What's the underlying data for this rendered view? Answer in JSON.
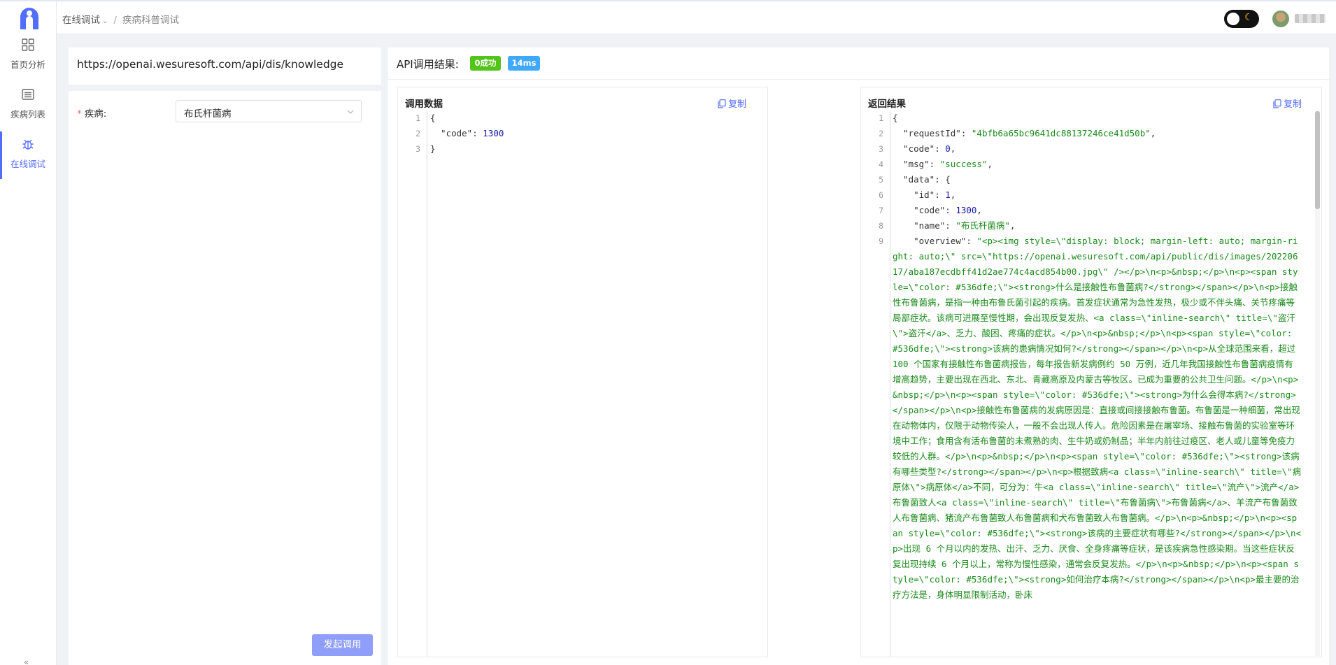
{
  "sidebar": {
    "items": [
      {
        "label": "首页分析",
        "icon": "dashboard-grid-icon"
      },
      {
        "label": "疾病列表",
        "icon": "list-icon"
      },
      {
        "label": "在线调试",
        "icon": "bug-icon",
        "active": true
      }
    ],
    "collapse_label": "«"
  },
  "breadcrumb": {
    "parent": "在线调试",
    "separator": "/",
    "current": "疾病科普调试"
  },
  "header": {
    "theme_toggle_icon": "moon-icon"
  },
  "request": {
    "url": "https://openai.wesuresoft.com/api/dis/knowledge"
  },
  "form": {
    "disease_label": "疾病:",
    "required_mark": "*",
    "disease_value": "布氏杆菌病",
    "submit_label": "发起调用"
  },
  "result": {
    "title": "API调用结果:",
    "status_badge": "0成功",
    "time_badge": "14ms",
    "colors": {
      "success": "#52c41a",
      "time": "#40a9ff",
      "accent": "#536dfe"
    }
  },
  "call_data": {
    "title": "调用数据",
    "copy_label": "复制",
    "lines": [
      "{",
      "  \"code\": 1300",
      "}"
    ]
  },
  "response": {
    "title": "返回结果",
    "copy_label": "复制",
    "request_id": "\"4bfb6a65bc9641dc88137246ce41d50b\"",
    "code": "0",
    "msg": "\"success\"",
    "data_id": "1",
    "data_code": "1300",
    "data_name": "\"布氏杆菌病\"",
    "overview_key": "\"overview\"",
    "overview_text": "\"<p><img style=\\\"display: block; margin-left: auto; margin-right: auto;\\\" src=\\\"https://openai.wesuresoft.com/api/public/dis/images/20220617/aba187ecdbff41d2ae774c4acd854b00.jpg\\\" /></p>\\n<p>&nbsp;</p>\\n<p><span style=\\\"color: #536dfe;\\\"><strong>什么是接触性布鲁菌病?</strong></span></p>\\n<p>接触性布鲁菌病，是指一种由布鲁氏菌引起的疾病。首发症状通常为急性发热，极少或不伴头痛、关节疼痛等局部症状。该病可进展至慢性期，会出现反复发热、<a class=\\\"inline-search\\\" title=\\\"盗汗\\\">盗汗</a>、乏力、酸困、疼痛的症状。</p>\\n<p>&nbsp;</p>\\n<p><span style=\\\"color: #536dfe;\\\"><strong>该病的患病情况如何?</strong></span></p>\\n<p>从全球范围来看，超过 100 个国家有接触性布鲁菌病报告，每年报告新发病例约 50 万例，近几年我国接触性布鲁菌病疫情有增高趋势，主要出现在西北、东北、青藏高原及内蒙古等牧区。已成为重要的公共卫生问题。</p>\\n<p>&nbsp;</p>\\n<p><span style=\\\"color: #536dfe;\\\"><strong>为什么会得本病?</strong></span></p>\\n<p>接触性布鲁菌病的发病原因是：直接或间接接触布鲁菌。布鲁菌是一种细菌，常出现在动物体内，仅限于动物传染人，一般不会出现人传人。危险因素是在屠宰场、接触布鲁菌的实验室等环境中工作；食用含有活布鲁菌的未煮熟的肉、生牛奶或奶制品；半年内前往过疫区、老人或儿童等免疫力较低的人群。</p>\\n<p>&nbsp;</p>\\n<p><span style=\\\"color: #536dfe;\\\"><strong>该病有哪些类型?</strong></span></p>\\n<p>根据致病<a class=\\\"inline-search\\\" title=\\\"病原体\\\">病原体</a>不同，可分为：牛<a class=\\\"inline-search\\\" title=\\\"流产\\\">流产</a>布鲁菌致人<a class=\\\"inline-search\\\" title=\\\"布鲁菌病\\\">布鲁菌病</a>、羊流产布鲁菌致人布鲁菌病、猪流产布鲁菌致人布鲁菌病和犬布鲁菌致人布鲁菌病。</p>\\n<p>&nbsp;</p>\\n<p><span style=\\\"color: #536dfe;\\\"><strong>该病的主要症状有哪些?</strong></span></p>\\n<p>出现 6 个月以内的发热、出汗、乏力、厌食、全身疼痛等症状，是该疾病急性感染期。当这些症状反复出现持续 6 个月以上，常称为慢性感染，通常会反复发热。</p>\\n<p>&nbsp;</p>\\n<p><span style=\\\"color: #536dfe;\\\"><strong>如何治疗本病?</strong></span></p>\\n<p>最主要的治疗方法是，身体明显限制活动，卧床"
  }
}
